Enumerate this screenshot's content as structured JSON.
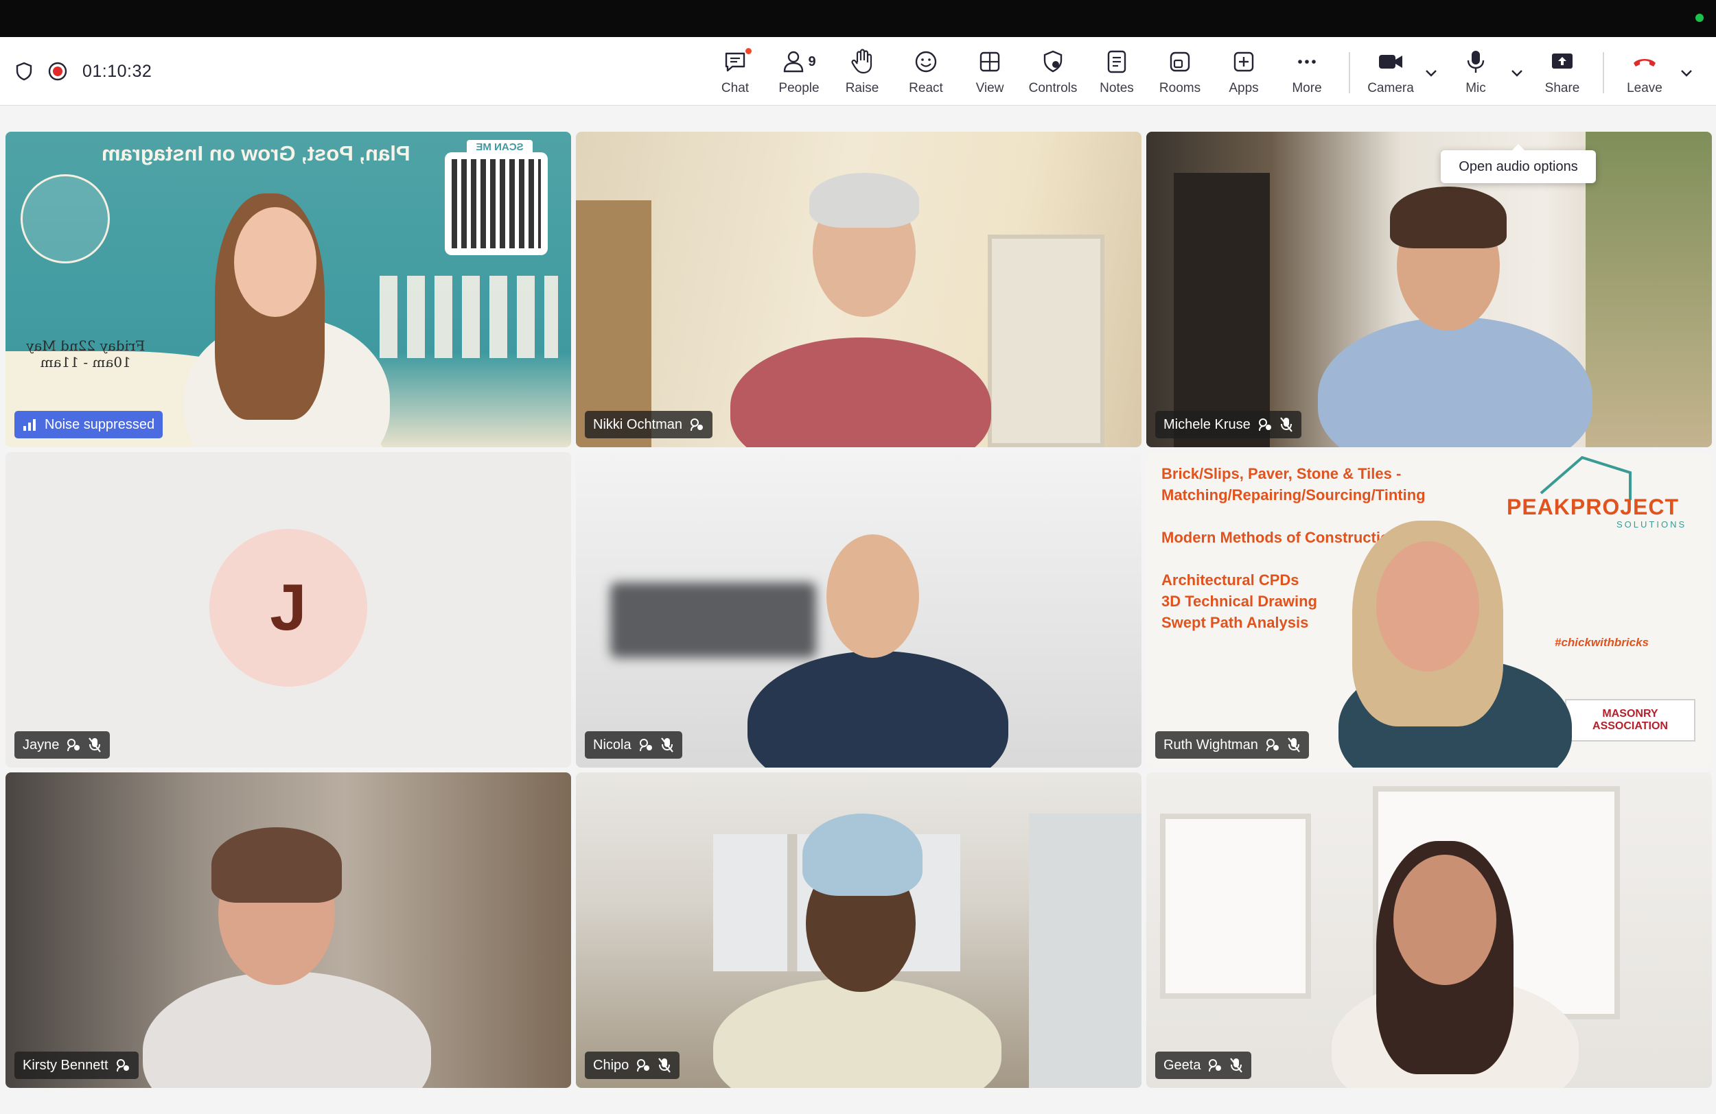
{
  "window": {
    "status_dot_color": "#19c34a"
  },
  "toolbar": {
    "timer": "01:10:32",
    "recording_color": "#e02b2b",
    "buttons": {
      "chat": {
        "label": "Chat",
        "icon": "chat-icon"
      },
      "people": {
        "label": "People",
        "icon": "people-icon",
        "count": "9"
      },
      "raise": {
        "label": "Raise",
        "icon": "hand-icon"
      },
      "react": {
        "label": "React",
        "icon": "smiley-icon"
      },
      "view": {
        "label": "View",
        "icon": "grid-icon"
      },
      "controls": {
        "label": "Controls",
        "icon": "controls-icon"
      },
      "notes": {
        "label": "Notes",
        "icon": "notes-icon"
      },
      "rooms": {
        "label": "Rooms",
        "icon": "rooms-icon"
      },
      "apps": {
        "label": "Apps",
        "icon": "plus-icon"
      },
      "more": {
        "label": "More",
        "icon": "ellipsis-icon"
      },
      "camera": {
        "label": "Camera",
        "icon": "camera-icon"
      },
      "mic": {
        "label": "Mic",
        "icon": "mic-icon"
      },
      "share": {
        "label": "Share",
        "icon": "share-icon"
      },
      "leave": {
        "label": "Leave",
        "icon": "phone-hangup-icon",
        "color": "#e02b2b"
      }
    }
  },
  "tooltip": {
    "text": "Open audio options"
  },
  "tiles": {
    "t1": {
      "status": "Noise suppressed",
      "banner_title": "Plan, Post, Grow on Instagram",
      "scan": "SCAN ME",
      "date_line1": "Friday 22nd May",
      "date_line2": "10am - 11am"
    },
    "t2": {
      "name": "Nikki Ochtman"
    },
    "t3": {
      "name": "Michele Kruse"
    },
    "t4": {
      "name": "Jayne",
      "initial": "J"
    },
    "t5": {
      "name": "Nicola"
    },
    "t6": {
      "name": "Ruth Wightman",
      "lines": [
        "Brick/Slips, Paver, Stone & Tiles -",
        "Matching/Repairing/Sourcing/Tinting",
        "",
        "Modern Methods of Construction",
        "",
        "Architectural CPDs",
        "3D Technical Drawing",
        "Swept Path Analysis"
      ],
      "brand": "PEAKPROJECT",
      "brand_sub": "SOLUTIONS",
      "hashtag": "#chickwithbricks",
      "badge": "MASONRY ASSOCIATION"
    },
    "t7": {
      "name": "Kirsty Bennett"
    },
    "t8": {
      "name": "Chipo"
    },
    "t9": {
      "name": "Geeta"
    }
  }
}
